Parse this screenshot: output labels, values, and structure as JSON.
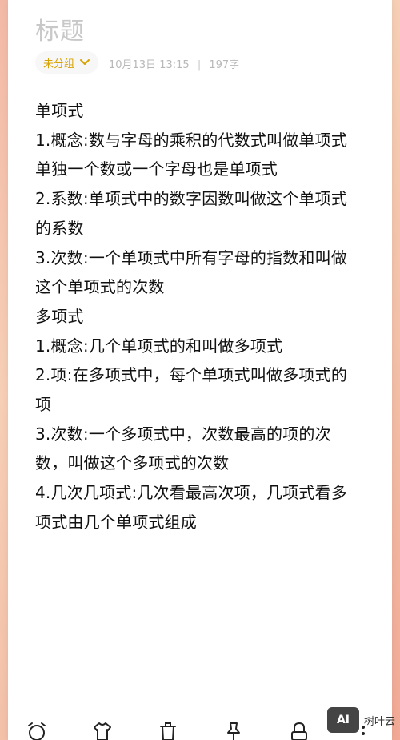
{
  "note": {
    "title": "标题",
    "group": "未分组",
    "date": "10月13日 13:15",
    "separator": "|",
    "word_count": "197字",
    "lines": [
      "单项式",
      "1.概念:数与字母的乘积的代数式叫做单项式",
      "单独一个数或一个字母也是单项式",
      "2.系数:单项式中的数字因数叫做这个单项式",
      "的系数",
      "3.次数:一个单项式中所有字母的指数和叫做",
      "这个单项式的次数",
      "多项式",
      "1.概念:几个单项式的和叫做多项式",
      "2.项:在多项式中，每个单项式叫做多项式的",
      "项",
      "3.次数:一个多项式中，次数最高的项的次",
      "数，叫做这个多项式的次数",
      "4.几次几项式:几次看最高次项，几项式看多",
      "项式由几个单项式组成"
    ]
  },
  "toolbar": {
    "icons": [
      "alarm-icon",
      "shirt-icon",
      "trash-icon",
      "pin-icon",
      "lock-icon",
      "more-icon"
    ]
  },
  "watermark": {
    "badge": "AI",
    "text": "树叶云"
  },
  "colors": {
    "accent": "#d8a200",
    "title_gray": "#c8c8c8",
    "background_peach": "#f3c0a8"
  }
}
